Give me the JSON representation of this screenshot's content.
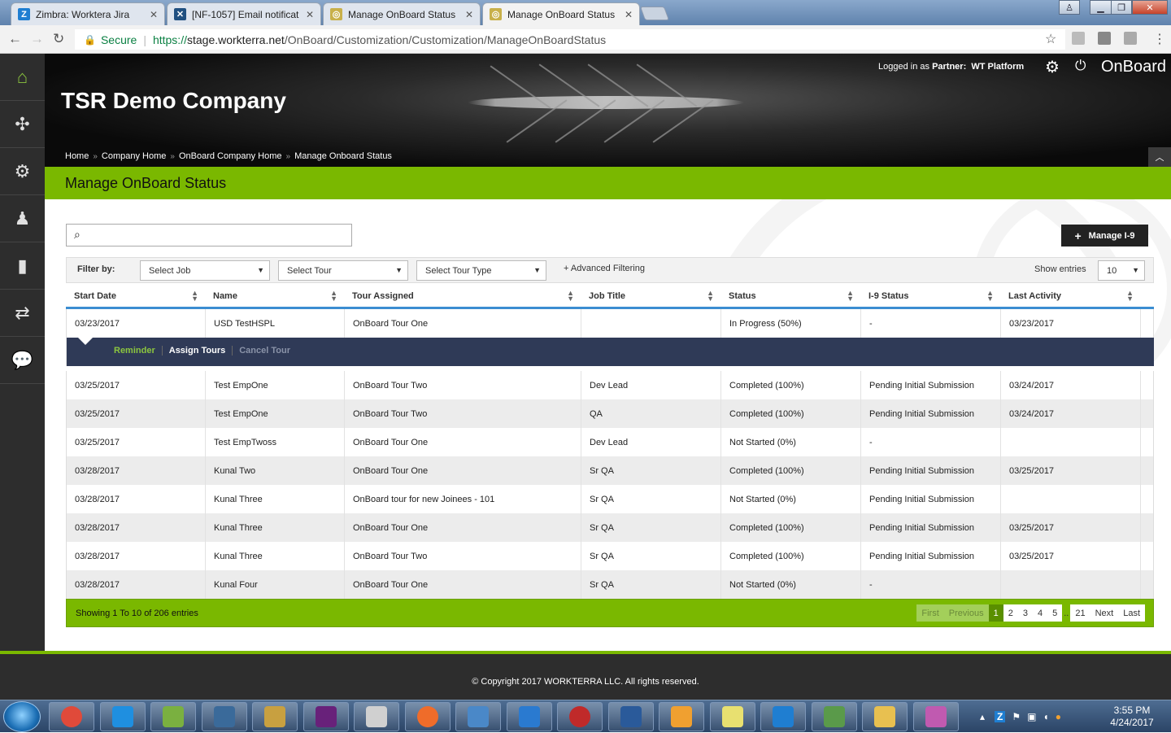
{
  "browser": {
    "tabs": [
      {
        "title": "Zimbra: Worktera Jira",
        "icon": "zimbra-icon",
        "color": "#1f7ed1",
        "glyph": "Z"
      },
      {
        "title": "[NF-1057] Email notificat",
        "icon": "jira-icon",
        "color": "#205081",
        "glyph": "✕"
      },
      {
        "title": "Manage OnBoard Status",
        "icon": "onboard-favicon",
        "color": "#c8b04a",
        "glyph": "◎"
      },
      {
        "title": "Manage OnBoard Status",
        "icon": "onboard-favicon",
        "color": "#c8b04a",
        "glyph": "◎"
      }
    ],
    "close_glyph": "✕",
    "secure_label": "Secure",
    "url_scheme": "https://",
    "url_host": "stage.workterra.net",
    "url_path": "/OnBoard/Customization/Customization/ManageOnBoardStatus"
  },
  "sidebar": {
    "items": [
      {
        "name": "home-icon",
        "glyph": "⌂"
      },
      {
        "name": "puzzle-icon",
        "glyph": "✣"
      },
      {
        "name": "user-gear-icon",
        "glyph": "⚙"
      },
      {
        "name": "user-icon",
        "glyph": "♟"
      },
      {
        "name": "bar-chart-icon",
        "glyph": "▮"
      },
      {
        "name": "transfer-icon",
        "glyph": "⇄"
      },
      {
        "name": "chat-icon",
        "glyph": "💬"
      }
    ]
  },
  "header": {
    "company": "TSR Demo Company",
    "logged_in_prefix": "Logged in as",
    "logged_in_role": "Partner:",
    "logged_in_user": "WT Platform",
    "product": "OnBoard"
  },
  "breadcrumb": [
    "Home",
    "Company Home",
    "OnBoard Company Home",
    "Manage Onboard Status"
  ],
  "page_title": "Manage OnBoard Status",
  "toolbar": {
    "manage_i9_label": "Manage I-9",
    "filter_label": "Filter by:",
    "select_job": "Select Job",
    "select_tour": "Select Tour",
    "select_tour_type": "Select Tour Type",
    "advanced_filtering": "+ Advanced Filtering",
    "show_entries_label": "Show entries",
    "show_entries_value": "10"
  },
  "table": {
    "columns": [
      "Start Date",
      "Name",
      "Tour Assigned",
      "Job Title",
      "Status",
      "I-9 Status",
      "Last Activity"
    ],
    "first_row": [
      "03/23/2017",
      "USD TestHSPL",
      "OnBoard Tour One",
      "",
      "In Progress (50%)",
      "-",
      "03/23/2017"
    ],
    "actions": {
      "reminder": "Reminder",
      "assign": "Assign Tours",
      "cancel": "Cancel Tour",
      "colors": {
        "reminder": "#8cc63f",
        "assign": "#ffffff",
        "cancel": "#8a93a8"
      }
    },
    "rows": [
      [
        "03/25/2017",
        "Test EmpOne",
        "OnBoard Tour Two",
        "Dev Lead",
        "Completed (100%)",
        "Pending Initial Submission",
        "03/24/2017"
      ],
      [
        "03/25/2017",
        "Test EmpOne",
        "OnBoard Tour Two",
        "QA",
        "Completed (100%)",
        "Pending Initial Submission",
        "03/24/2017"
      ],
      [
        "03/25/2017",
        "Test EmpTwoss",
        "OnBoard Tour One",
        "Dev Lead",
        "Not Started (0%)",
        "-",
        ""
      ],
      [
        "03/28/2017",
        "Kunal Two",
        "OnBoard Tour One",
        "Sr QA",
        "Completed (100%)",
        "Pending Initial Submission",
        "03/25/2017"
      ],
      [
        "03/28/2017",
        "Kunal Three",
        "OnBoard tour for new Joinees - 101",
        "Sr QA",
        "Not Started (0%)",
        "Pending Initial Submission",
        ""
      ],
      [
        "03/28/2017",
        "Kunal Three",
        "OnBoard Tour One",
        "Sr QA",
        "Completed (100%)",
        "Pending Initial Submission",
        "03/25/2017"
      ],
      [
        "03/28/2017",
        "Kunal Three",
        "OnBoard Tour Two",
        "Sr QA",
        "Completed (100%)",
        "Pending Initial Submission",
        "03/25/2017"
      ],
      [
        "03/28/2017",
        "Kunal Four",
        "OnBoard Tour One",
        "Sr QA",
        "Not Started (0%)",
        "-",
        ""
      ]
    ],
    "showing": "Showing 1 To 10 of 206 entries",
    "pager": {
      "first": "First",
      "previous": "Previous",
      "pages": [
        "1",
        "2",
        "3",
        "4",
        "5"
      ],
      "ellipsis": "..",
      "last_page": "21",
      "next": "Next",
      "last": "Last",
      "current": "1"
    }
  },
  "footer": {
    "copyright": "© Copyright 2017 WORKTERRA LLC. All rights reserved."
  },
  "taskbar": {
    "apps": [
      {
        "name": "chrome-icon",
        "color": "#e04a3a"
      },
      {
        "name": "internet-explorer-icon",
        "color": "#1f8fe0"
      },
      {
        "name": "notepad-plus-icon",
        "color": "#7ab040"
      },
      {
        "name": "security-icon",
        "color": "#3a6a9a"
      },
      {
        "name": "tool-icon",
        "color": "#c8a040"
      },
      {
        "name": "visual-studio-icon",
        "color": "#68217a"
      },
      {
        "name": "vnc-icon",
        "color": "#d0d0d0"
      },
      {
        "name": "postman-icon",
        "color": "#ef6c2a"
      },
      {
        "name": "remote-desktop-icon",
        "color": "#4a88c8"
      },
      {
        "name": "filezilla-icon",
        "color": "#2a7ad0"
      },
      {
        "name": "screen-capture-icon",
        "color": "#c02a2a"
      },
      {
        "name": "network-icon",
        "color": "#2a5a9a"
      },
      {
        "name": "media-player-icon",
        "color": "#f0a030"
      },
      {
        "name": "sticky-notes-icon",
        "color": "#e8e070"
      },
      {
        "name": "zimbra-desktop-icon",
        "color": "#1f7ed1"
      },
      {
        "name": "calculator-icon",
        "color": "#5a9a4a"
      },
      {
        "name": "file-explorer-icon",
        "color": "#e8c050"
      },
      {
        "name": "paint-icon",
        "color": "#c05ab0"
      }
    ],
    "time": "3:55 PM",
    "date": "4/24/2017"
  }
}
